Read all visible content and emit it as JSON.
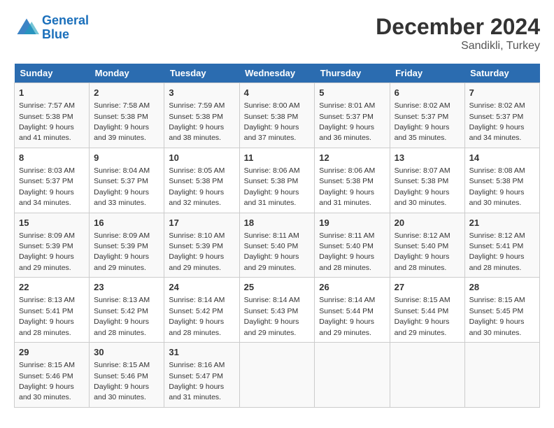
{
  "header": {
    "logo_line1": "General",
    "logo_line2": "Blue",
    "month": "December 2024",
    "location": "Sandikli, Turkey"
  },
  "days_of_week": [
    "Sunday",
    "Monday",
    "Tuesday",
    "Wednesday",
    "Thursday",
    "Friday",
    "Saturday"
  ],
  "weeks": [
    [
      {
        "day": "1",
        "sunrise": "7:57 AM",
        "sunset": "5:38 PM",
        "daylight": "9 hours and 41 minutes."
      },
      {
        "day": "2",
        "sunrise": "7:58 AM",
        "sunset": "5:38 PM",
        "daylight": "9 hours and 39 minutes."
      },
      {
        "day": "3",
        "sunrise": "7:59 AM",
        "sunset": "5:38 PM",
        "daylight": "9 hours and 38 minutes."
      },
      {
        "day": "4",
        "sunrise": "8:00 AM",
        "sunset": "5:38 PM",
        "daylight": "9 hours and 37 minutes."
      },
      {
        "day": "5",
        "sunrise": "8:01 AM",
        "sunset": "5:37 PM",
        "daylight": "9 hours and 36 minutes."
      },
      {
        "day": "6",
        "sunrise": "8:02 AM",
        "sunset": "5:37 PM",
        "daylight": "9 hours and 35 minutes."
      },
      {
        "day": "7",
        "sunrise": "8:02 AM",
        "sunset": "5:37 PM",
        "daylight": "9 hours and 34 minutes."
      }
    ],
    [
      {
        "day": "8",
        "sunrise": "8:03 AM",
        "sunset": "5:37 PM",
        "daylight": "9 hours and 34 minutes."
      },
      {
        "day": "9",
        "sunrise": "8:04 AM",
        "sunset": "5:37 PM",
        "daylight": "9 hours and 33 minutes."
      },
      {
        "day": "10",
        "sunrise": "8:05 AM",
        "sunset": "5:38 PM",
        "daylight": "9 hours and 32 minutes."
      },
      {
        "day": "11",
        "sunrise": "8:06 AM",
        "sunset": "5:38 PM",
        "daylight": "9 hours and 31 minutes."
      },
      {
        "day": "12",
        "sunrise": "8:06 AM",
        "sunset": "5:38 PM",
        "daylight": "9 hours and 31 minutes."
      },
      {
        "day": "13",
        "sunrise": "8:07 AM",
        "sunset": "5:38 PM",
        "daylight": "9 hours and 30 minutes."
      },
      {
        "day": "14",
        "sunrise": "8:08 AM",
        "sunset": "5:38 PM",
        "daylight": "9 hours and 30 minutes."
      }
    ],
    [
      {
        "day": "15",
        "sunrise": "8:09 AM",
        "sunset": "5:39 PM",
        "daylight": "9 hours and 29 minutes."
      },
      {
        "day": "16",
        "sunrise": "8:09 AM",
        "sunset": "5:39 PM",
        "daylight": "9 hours and 29 minutes."
      },
      {
        "day": "17",
        "sunrise": "8:10 AM",
        "sunset": "5:39 PM",
        "daylight": "9 hours and 29 minutes."
      },
      {
        "day": "18",
        "sunrise": "8:11 AM",
        "sunset": "5:40 PM",
        "daylight": "9 hours and 29 minutes."
      },
      {
        "day": "19",
        "sunrise": "8:11 AM",
        "sunset": "5:40 PM",
        "daylight": "9 hours and 28 minutes."
      },
      {
        "day": "20",
        "sunrise": "8:12 AM",
        "sunset": "5:40 PM",
        "daylight": "9 hours and 28 minutes."
      },
      {
        "day": "21",
        "sunrise": "8:12 AM",
        "sunset": "5:41 PM",
        "daylight": "9 hours and 28 minutes."
      }
    ],
    [
      {
        "day": "22",
        "sunrise": "8:13 AM",
        "sunset": "5:41 PM",
        "daylight": "9 hours and 28 minutes."
      },
      {
        "day": "23",
        "sunrise": "8:13 AM",
        "sunset": "5:42 PM",
        "daylight": "9 hours and 28 minutes."
      },
      {
        "day": "24",
        "sunrise": "8:14 AM",
        "sunset": "5:42 PM",
        "daylight": "9 hours and 28 minutes."
      },
      {
        "day": "25",
        "sunrise": "8:14 AM",
        "sunset": "5:43 PM",
        "daylight": "9 hours and 29 minutes."
      },
      {
        "day": "26",
        "sunrise": "8:14 AM",
        "sunset": "5:44 PM",
        "daylight": "9 hours and 29 minutes."
      },
      {
        "day": "27",
        "sunrise": "8:15 AM",
        "sunset": "5:44 PM",
        "daylight": "9 hours and 29 minutes."
      },
      {
        "day": "28",
        "sunrise": "8:15 AM",
        "sunset": "5:45 PM",
        "daylight": "9 hours and 30 minutes."
      }
    ],
    [
      {
        "day": "29",
        "sunrise": "8:15 AM",
        "sunset": "5:46 PM",
        "daylight": "9 hours and 30 minutes."
      },
      {
        "day": "30",
        "sunrise": "8:15 AM",
        "sunset": "5:46 PM",
        "daylight": "9 hours and 30 minutes."
      },
      {
        "day": "31",
        "sunrise": "8:16 AM",
        "sunset": "5:47 PM",
        "daylight": "9 hours and 31 minutes."
      },
      null,
      null,
      null,
      null
    ]
  ]
}
